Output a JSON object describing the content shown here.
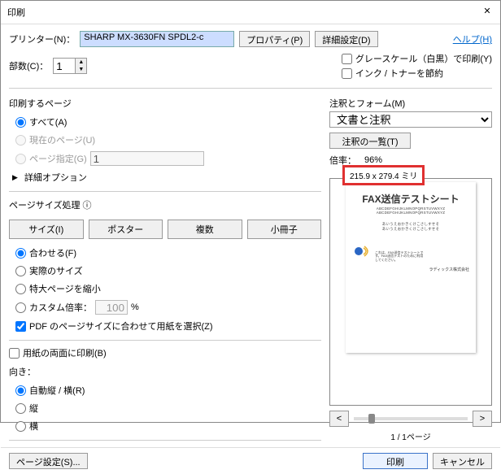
{
  "window": {
    "title": "印刷"
  },
  "labels": {
    "printer": "プリンター(N)：",
    "properties": "プロパティ(P)",
    "advanced": "詳細設定(D)",
    "help": "ヘルプ(H)",
    "copies": "部数(C)：",
    "grayscale": "グレースケール（白黒）で印刷(Y)",
    "save_ink": "インク / トナーを節約",
    "pages_to_print": "印刷するページ",
    "all": "すべて(A)",
    "current": "現在のページ(U)",
    "range": "ページ指定(G)",
    "more_options": "詳細オプション",
    "page_sizing": "ページサイズ処理 ⓘ",
    "btn_size": "サイズ(I)",
    "btn_poster": "ポスター",
    "btn_multi": "複数",
    "btn_booklet": "小冊子",
    "fit": "合わせる(F)",
    "actual": "実際のサイズ",
    "shrink": "特大ページを縮小",
    "custom_scale": "カスタム倍率：",
    "choose_paper": "PDF のページサイズに合わせて用紙を選択(Z)",
    "both_sides": "用紙の両面に印刷(B)",
    "orientation": "向き：",
    "auto": "自動縦 / 横(R)",
    "portrait": "縦",
    "landscape": "横",
    "comments_forms": "注釈とフォーム(M)",
    "comments_summary": "注釈の一覧(T)",
    "scale_label": "倍率：",
    "page_setup": "ページ設定(S)...",
    "print": "印刷",
    "cancel": "キャンセル",
    "page_of": "1 / 1ページ"
  },
  "values": {
    "printer_selected": "SHARP MX-3630FN SPDL2-c",
    "copies": "1",
    "range_input": "1",
    "custom_scale": "100",
    "percent": "%",
    "comments_form_selected": "文書と注釈",
    "scale_pct": "96%",
    "dimensions": "215.9 x 279.4 ミリ",
    "nav_prev": "<",
    "nav_next": ">"
  },
  "preview": {
    "title": "FAX送信テストシート",
    "line1": "ABCDEFGHIJKLMNOPQRSTUVWXYZ",
    "line2": "ABCDEFGHIJKLMNOPQRSTUVWXYZ",
    "kana1": "あいうえおかきくけこさしすせそ",
    "kana2": "あいうえおかきくけこさしすせそ",
    "small1": "これは、FAX送信テストシートです。FAX送信テストのために利用してください。",
    "footer": "ラディックス株式会社"
  }
}
